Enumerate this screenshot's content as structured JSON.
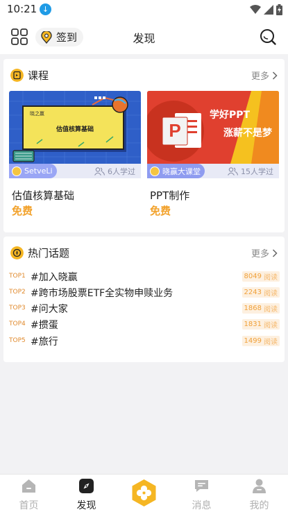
{
  "status_bar": {
    "time": "10:21"
  },
  "header": {
    "checkin_label": "签到",
    "title": "发现"
  },
  "course_section": {
    "title": "课程",
    "more_label": "更多",
    "courses": [
      {
        "title": "估值核算基础",
        "price": "免费",
        "author": "SetveLi",
        "learners": "6人学过",
        "thumb_brand": "晓之赢",
        "thumb_text": "估值核算基础",
        "pill_color": "#9aa6f5"
      },
      {
        "title": "PPT制作",
        "price": "免费",
        "author": "晓赢大课堂",
        "learners": "15人学过",
        "thumb_line1": "学好PPT",
        "thumb_line2": "涨薪不是梦",
        "pill_color": "#8f9cf0"
      }
    ]
  },
  "topic_section": {
    "title": "热门话题",
    "more_label": "更多",
    "views_suffix": "阅读",
    "topics": [
      {
        "rank": "TOP1",
        "name": "#加入晓赢",
        "views": "8049"
      },
      {
        "rank": "TOP2",
        "name": "#跨市场股票ETF全实物申赎业务",
        "views": "2243"
      },
      {
        "rank": "TOP3",
        "name": "#问大家",
        "views": "1868"
      },
      {
        "rank": "TOP4",
        "name": "#掼蛋",
        "views": "1831"
      },
      {
        "rank": "TOP5",
        "name": "#旅行",
        "views": "1499"
      }
    ]
  },
  "bottom_nav": {
    "items": [
      {
        "label": "首页",
        "icon": "home-icon",
        "active": false
      },
      {
        "label": "发现",
        "icon": "compass-icon",
        "active": true
      },
      {
        "label": "",
        "icon": "clover-icon",
        "active": false
      },
      {
        "label": "消息",
        "icon": "chat-bubble-icon",
        "active": false
      },
      {
        "label": "我的",
        "icon": "person-icon",
        "active": false
      }
    ]
  },
  "colors": {
    "accent": "#f5b623",
    "price": "#f2a12a",
    "rank": "#e08a2d",
    "page_bg": "#f2f2f4"
  }
}
